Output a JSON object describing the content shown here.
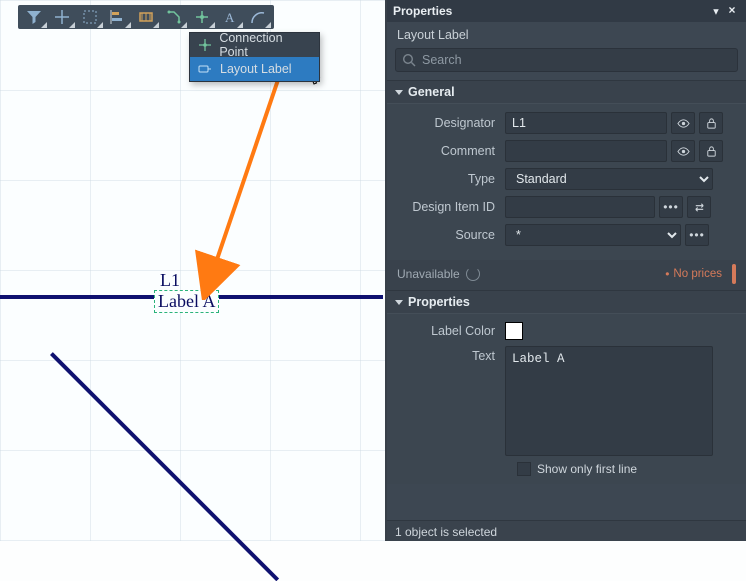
{
  "toolbar": {
    "buttons": [
      {
        "name": "filter-icon"
      },
      {
        "name": "crosshair-icon"
      },
      {
        "name": "select-box-icon"
      },
      {
        "name": "align-icon"
      },
      {
        "name": "bus-icon"
      },
      {
        "name": "net-icon"
      },
      {
        "name": "connection-icon"
      },
      {
        "name": "text-icon"
      },
      {
        "name": "arc-icon"
      }
    ]
  },
  "context_menu": {
    "items": [
      {
        "icon": "connection-icon",
        "label": "Connection Point",
        "selected": false
      },
      {
        "icon": "layout-label-icon",
        "label": "Layout Label",
        "selected": true
      }
    ]
  },
  "canvas": {
    "designator": "L1",
    "label_text": "Label A"
  },
  "panel": {
    "title": "Properties",
    "subtype": "Layout Label",
    "search_placeholder": "Search",
    "sections": {
      "general": {
        "header": "General",
        "designator_label": "Designator",
        "designator_value": "L1",
        "comment_label": "Comment",
        "comment_value": "",
        "type_label": "Type",
        "type_value": "Standard",
        "design_item_id_label": "Design Item ID",
        "design_item_id_value": "",
        "source_label": "Source",
        "source_value": "*"
      },
      "pricing": {
        "unavailable": "Unavailable",
        "noprices": "No prices"
      },
      "properties": {
        "header": "Properties",
        "label_color_label": "Label Color",
        "label_color_value": "#ffffff",
        "text_label": "Text",
        "text_value": "Label A",
        "show_only_first_line_label": "Show only first line",
        "show_only_first_line_checked": false
      }
    },
    "status": "1 object is selected"
  }
}
